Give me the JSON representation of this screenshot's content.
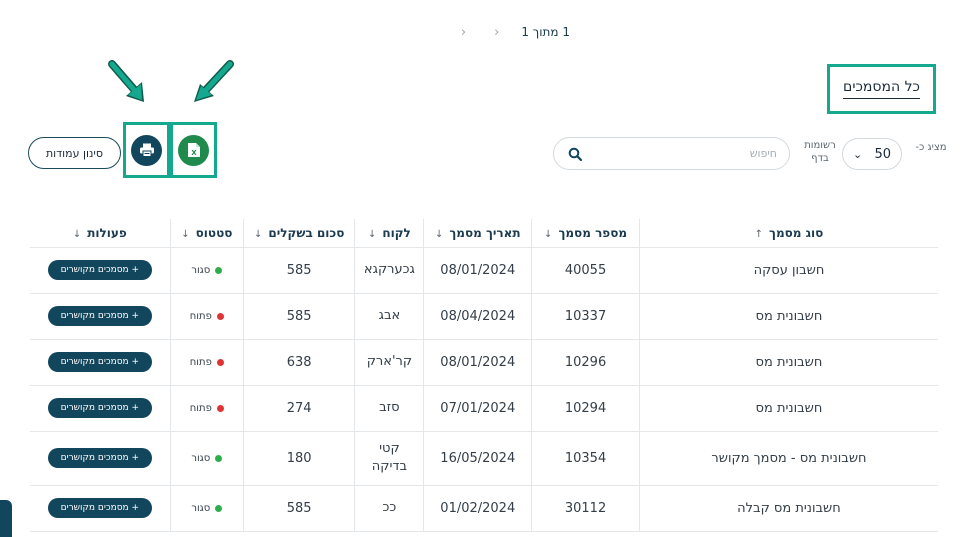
{
  "pagination": {
    "text": "1 מתוך 1",
    "prev_icon": "chevron-left-icon",
    "next_icon": "chevron-left-icon"
  },
  "title": "כל המסמכים",
  "toolbar": {
    "filter_columns_label": "סינון עמודות",
    "print_icon": "printer-icon",
    "excel_icon": "excel-icon",
    "search_placeholder": "חיפוש",
    "per_page_label": "רשומות בדף",
    "per_page_value": "50",
    "show_label": "מציג כ-"
  },
  "colors": {
    "accent": "#14a88f",
    "primary": "#12465c",
    "excel": "#1f8a4c",
    "closed": "#2eae4a",
    "open": "#e03434"
  },
  "table": {
    "headers": {
      "doc_type": "סוג מסמך",
      "doc_number": "מספר מסמך",
      "doc_date": "תאריך מסמך",
      "customer": "לקוח",
      "amount": "סכום בשקלים",
      "status": "סטטוס",
      "actions": "פעולות"
    },
    "sort_up": "↑",
    "sort_down": "↓",
    "action_label": "+ מסמכים מקושרים",
    "rows": [
      {
        "doc_type": "חשבון עסקה",
        "doc_number": "40055",
        "doc_date": "08/01/2024",
        "customer": "גכערקגא",
        "amount": "585",
        "status": "סגור",
        "status_kind": "closed"
      },
      {
        "doc_type": "חשבונית מס",
        "doc_number": "10337",
        "doc_date": "08/04/2024",
        "customer": "אבג",
        "amount": "585",
        "status": "פתוח",
        "status_kind": "open"
      },
      {
        "doc_type": "חשבונית מס",
        "doc_number": "10296",
        "doc_date": "08/01/2024",
        "customer": "קר'ארק",
        "amount": "638",
        "status": "פתוח",
        "status_kind": "open"
      },
      {
        "doc_type": "חשבונית מס",
        "doc_number": "10294",
        "doc_date": "07/01/2024",
        "customer": "סזב",
        "amount": "274",
        "status": "פתוח",
        "status_kind": "open"
      },
      {
        "doc_type": "חשבונית מס - מסמך מקושר",
        "doc_number": "10354",
        "doc_date": "16/05/2024",
        "customer_line1": "קטי",
        "customer_line2": "בדיקה",
        "amount": "180",
        "status": "סגור",
        "status_kind": "closed"
      },
      {
        "doc_type": "חשבונית מס קבלה",
        "doc_number": "30112",
        "doc_date": "01/02/2024",
        "customer": "ככ",
        "amount": "585",
        "status": "סגור",
        "status_kind": "closed"
      }
    ]
  }
}
